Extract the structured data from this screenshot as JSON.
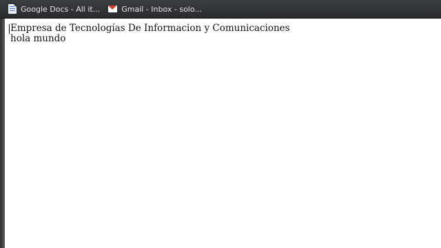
{
  "bookmarks": [
    {
      "label": "Google Docs - All it...",
      "icon": "docs-icon"
    },
    {
      "label": "Gmail - Inbox - solo...",
      "icon": "gmail-icon"
    }
  ],
  "page": {
    "line1": "Empresa de Tecnologías De Informacion y Comunicaciones",
    "line2": "hola mundo"
  }
}
